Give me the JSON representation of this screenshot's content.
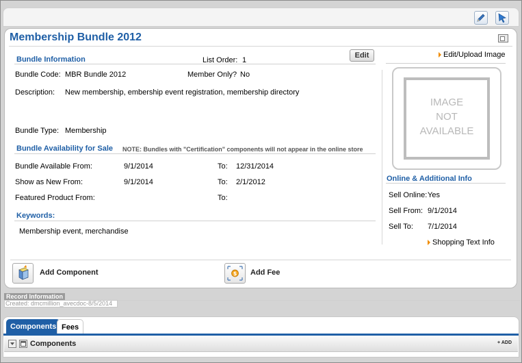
{
  "toolbar": {
    "edit_icon": "pencil-icon",
    "select_icon": "cursor-icon"
  },
  "title": "Membership Bundle 2012",
  "bundle_info": {
    "heading": "Bundle Information",
    "list_order_label": "List Order:",
    "list_order_value": "1",
    "edit_label": "Edit",
    "code_label": "Bundle Code:",
    "code_value": "MBR Bundle 2012",
    "member_only_label": "Member Only?",
    "member_only_value": "No",
    "description_label": "Description:",
    "description_value": "New membership, embership event registration, membership directory",
    "type_label": "Bundle Type:",
    "type_value": "Membership"
  },
  "availability": {
    "heading": "Bundle Availability for Sale",
    "note": "NOTE: Bundles with \"Certification\" components will not appear in the online store",
    "rows": [
      {
        "label": "Bundle Available From:",
        "from": "9/1/2014",
        "to_label": "To:",
        "to": "12/31/2014"
      },
      {
        "label": "Show as New From:",
        "from": "9/1/2014",
        "to_label": "To:",
        "to": "2/1/2012"
      },
      {
        "label": "Featured Product From:",
        "from": "",
        "to_label": "To:",
        "to": ""
      }
    ]
  },
  "keywords": {
    "heading": "Keywords:",
    "value": "Membership event, merchandise"
  },
  "image": {
    "link": "Edit/Upload Image",
    "placeholder_line1": "IMAGE",
    "placeholder_line2": "NOT",
    "placeholder_line3": "AVAILABLE"
  },
  "online": {
    "heading": "Online & Additional Info",
    "sell_online_label": "Sell Online:",
    "sell_online_value": "Yes",
    "sell_from_label": "Sell From:",
    "sell_from_value": "9/1/2014",
    "sell_to_label": "Sell To:",
    "sell_to_value": "7/1/2014",
    "shopping_link": "Shopping Text Info"
  },
  "actions": {
    "add_component": "Add Component",
    "add_fee": "Add Fee"
  },
  "record": {
    "heading": "Record Information",
    "created": "Created: dmcmillion_avecdoc-8/5/2014"
  },
  "tabs": [
    {
      "label": "Components"
    },
    {
      "label": "Fees"
    }
  ],
  "components_panel": {
    "title": "Components",
    "add_label": "ADD"
  },
  "colors": {
    "accent": "#1f5fa6",
    "link_arrow": "#f08c00"
  }
}
